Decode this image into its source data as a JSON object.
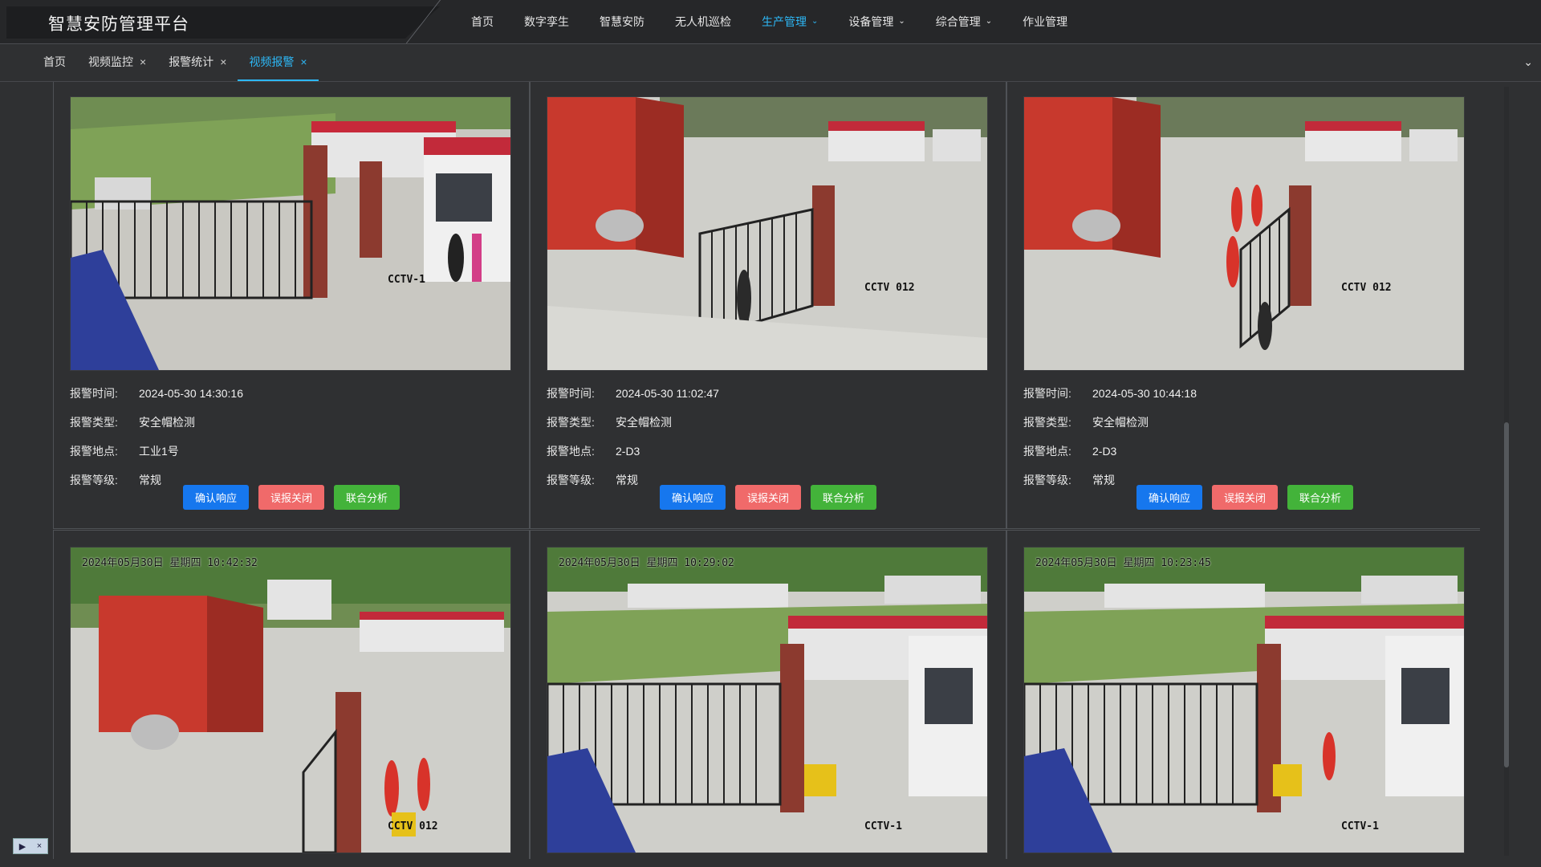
{
  "app": {
    "title": "智慧安防管理平台"
  },
  "nav": [
    {
      "label": "首页",
      "dropdown": false,
      "active": false
    },
    {
      "label": "数字孪生",
      "dropdown": false,
      "active": false
    },
    {
      "label": "智慧安防",
      "dropdown": false,
      "active": false
    },
    {
      "label": "无人机巡检",
      "dropdown": false,
      "active": false
    },
    {
      "label": "生产管理",
      "dropdown": true,
      "active": true
    },
    {
      "label": "设备管理",
      "dropdown": true,
      "active": false
    },
    {
      "label": "综合管理",
      "dropdown": true,
      "active": false
    },
    {
      "label": "作业管理",
      "dropdown": false,
      "active": false
    }
  ],
  "tabs": [
    {
      "label": "首页",
      "closable": false,
      "active": false
    },
    {
      "label": "视频监控",
      "closable": true,
      "active": false
    },
    {
      "label": "报警统计",
      "closable": true,
      "active": false
    },
    {
      "label": "视频报警",
      "closable": true,
      "active": true
    }
  ],
  "labels": {
    "time": "报警时间:",
    "type": "报警类型:",
    "location": "报警地点:",
    "level": "报警等级:",
    "confirm": "确认响应",
    "false_close": "误报关闭",
    "joint": "联合分析"
  },
  "alarms": [
    {
      "camera": "CCTV-1",
      "timestamp_overlay": "",
      "time": "2024-05-30 14:30:16",
      "type": "安全帽检测",
      "location": "工业1号",
      "level": "常规"
    },
    {
      "camera": "CCTV 012",
      "timestamp_overlay": "",
      "time": "2024-05-30 11:02:47",
      "type": "安全帽检测",
      "location": "2-D3",
      "level": "常规"
    },
    {
      "camera": "CCTV 012",
      "timestamp_overlay": "",
      "time": "2024-05-30 10:44:18",
      "type": "安全帽检测",
      "location": "2-D3",
      "level": "常规"
    },
    {
      "camera": "CCTV 012",
      "timestamp_overlay": "2024年05月30日 星期四 10:42:32"
    },
    {
      "camera": "CCTV-1",
      "timestamp_overlay": "2024年05月30日 星期四 10:29:02"
    },
    {
      "camera": "CCTV-1",
      "timestamp_overlay": "2024年05月30日 星期四 10:23:45"
    }
  ]
}
